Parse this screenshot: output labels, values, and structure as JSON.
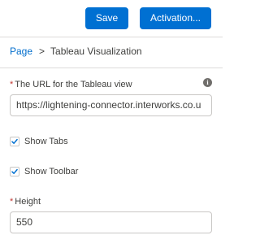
{
  "toolbar": {
    "save_label": "Save",
    "activation_label": "Activation..."
  },
  "breadcrumb": {
    "page": "Page",
    "separator": ">",
    "current": "Tableau Visualization"
  },
  "fields": {
    "url": {
      "required_marker": "*",
      "label": "The URL for the Tableau view",
      "value": "https://lightening-connector.interworks.co.u",
      "info_icon": "info-icon"
    },
    "show_tabs": {
      "label": "Show Tabs",
      "checked": true
    },
    "show_toolbar": {
      "label": "Show Toolbar",
      "checked": true
    },
    "height": {
      "required_marker": "*",
      "label": "Height",
      "value": "550"
    }
  },
  "colors": {
    "brand": "#0070d2",
    "link": "#006dcc",
    "required": "#c23934",
    "text": "#3e3e3c",
    "border": "#c9c7c5"
  }
}
